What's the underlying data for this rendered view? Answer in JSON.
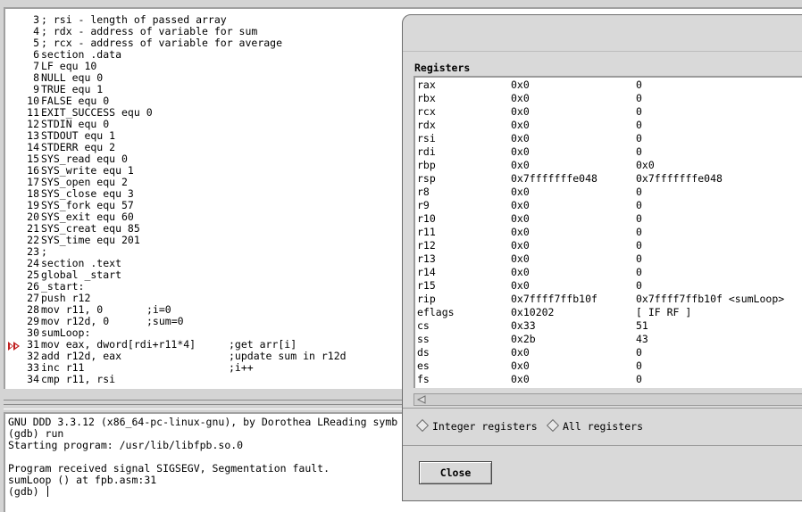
{
  "source": {
    "lines": [
      {
        "n": "3",
        "code": "; rsi - length of passed array",
        "comment": ""
      },
      {
        "n": "4",
        "code": "; rdx - address of variable for sum",
        "comment": ""
      },
      {
        "n": "5",
        "code": "; rcx - address of variable for average",
        "comment": ""
      },
      {
        "n": "6",
        "code": "section .data",
        "comment": ""
      },
      {
        "n": "7",
        "code": "LF equ 10",
        "comment": ""
      },
      {
        "n": "8",
        "code": "NULL equ 0",
        "comment": ""
      },
      {
        "n": "9",
        "code": "TRUE equ 1",
        "comment": ""
      },
      {
        "n": "10",
        "code": "FALSE equ 0",
        "comment": ""
      },
      {
        "n": "11",
        "code": "EXIT_SUCCESS equ 0",
        "comment": ""
      },
      {
        "n": "12",
        "code": "STDIN equ 0",
        "comment": ""
      },
      {
        "n": "13",
        "code": "STDOUT equ 1",
        "comment": ""
      },
      {
        "n": "14",
        "code": "STDERR equ 2",
        "comment": ""
      },
      {
        "n": "15",
        "code": "SYS_read equ 0",
        "comment": ""
      },
      {
        "n": "16",
        "code": "SYS_write equ 1",
        "comment": ""
      },
      {
        "n": "17",
        "code": "SYS_open equ 2",
        "comment": ""
      },
      {
        "n": "18",
        "code": "SYS_close equ 3",
        "comment": ""
      },
      {
        "n": "19",
        "code": "SYS_fork equ 57",
        "comment": ""
      },
      {
        "n": "20",
        "code": "SYS_exit equ 60",
        "comment": ""
      },
      {
        "n": "21",
        "code": "SYS_creat equ 85",
        "comment": ""
      },
      {
        "n": "22",
        "code": "SYS_time equ 201",
        "comment": ""
      },
      {
        "n": "23",
        "code": ";",
        "comment": ""
      },
      {
        "n": "24",
        "code": "section .text",
        "comment": ""
      },
      {
        "n": "25",
        "code": "global _start",
        "comment": ""
      },
      {
        "n": "26",
        "code": "_start:",
        "comment": ""
      },
      {
        "n": "27",
        "code": "push r12",
        "comment": ""
      },
      {
        "n": "28",
        "code": "mov r11, 0",
        "comment2": ";i=0"
      },
      {
        "n": "29",
        "code": "mov r12d, 0",
        "comment2": ";sum=0"
      },
      {
        "n": "30",
        "code": "sumLoop:",
        "comment": ""
      },
      {
        "n": "31",
        "code": "mov eax, dword[rdi+r11*4]",
        "comment": ";get arr[i]"
      },
      {
        "n": "32",
        "code": "add r12d, eax",
        "comment": ";update sum in r12d"
      },
      {
        "n": "33",
        "code": "inc r11",
        "comment": ";i++"
      },
      {
        "n": "34",
        "code": "cmp r11, rsi",
        "comment": ""
      }
    ]
  },
  "console": {
    "lines": [
      "GNU DDD 3.3.12 (x86_64-pc-linux-gnu), by Dorothea LReading symb",
      "(gdb) run",
      "Starting program: /usr/lib/libfpb.so.0",
      "",
      "Program received signal SIGSEGV, Segmentation fault.",
      "sumLoop () at fpb.asm:31",
      "(gdb) "
    ]
  },
  "registers": {
    "title": "Registers",
    "rows": [
      {
        "name": "rax",
        "raw": "0x0",
        "natural": "0"
      },
      {
        "name": "rbx",
        "raw": "0x0",
        "natural": "0"
      },
      {
        "name": "rcx",
        "raw": "0x0",
        "natural": "0"
      },
      {
        "name": "rdx",
        "raw": "0x0",
        "natural": "0"
      },
      {
        "name": "rsi",
        "raw": "0x0",
        "natural": "0"
      },
      {
        "name": "rdi",
        "raw": "0x0",
        "natural": "0"
      },
      {
        "name": "rbp",
        "raw": "0x0",
        "natural": "0x0"
      },
      {
        "name": "rsp",
        "raw": "0x7fffffffe048",
        "natural": "0x7fffffffe048"
      },
      {
        "name": "r8",
        "raw": "0x0",
        "natural": "0"
      },
      {
        "name": "r9",
        "raw": "0x0",
        "natural": "0"
      },
      {
        "name": "r10",
        "raw": "0x0",
        "natural": "0"
      },
      {
        "name": "r11",
        "raw": "0x0",
        "natural": "0"
      },
      {
        "name": "r12",
        "raw": "0x0",
        "natural": "0"
      },
      {
        "name": "r13",
        "raw": "0x0",
        "natural": "0"
      },
      {
        "name": "r14",
        "raw": "0x0",
        "natural": "0"
      },
      {
        "name": "r15",
        "raw": "0x0",
        "natural": "0"
      },
      {
        "name": "rip",
        "raw": "0x7ffff7ffb10f",
        "natural": "0x7ffff7ffb10f <sumLoop>"
      },
      {
        "name": "eflags",
        "raw": "0x10202",
        "natural": "[ IF RF ]"
      },
      {
        "name": "cs",
        "raw": "0x33",
        "natural": "51"
      },
      {
        "name": "ss",
        "raw": "0x2b",
        "natural": "43"
      },
      {
        "name": "ds",
        "raw": "0x0",
        "natural": "0"
      },
      {
        "name": "es",
        "raw": "0x0",
        "natural": "0"
      },
      {
        "name": "fs",
        "raw": "0x0",
        "natural": "0"
      }
    ],
    "option_integer": "Integer registers",
    "option_all": "All registers",
    "close_label": "Close"
  },
  "colors": {
    "exec_arrow": "#c02020"
  },
  "icons": {
    "exec_arrow": "execution-arrow-icon",
    "scroll_left": "scroll-left-arrow-icon"
  }
}
